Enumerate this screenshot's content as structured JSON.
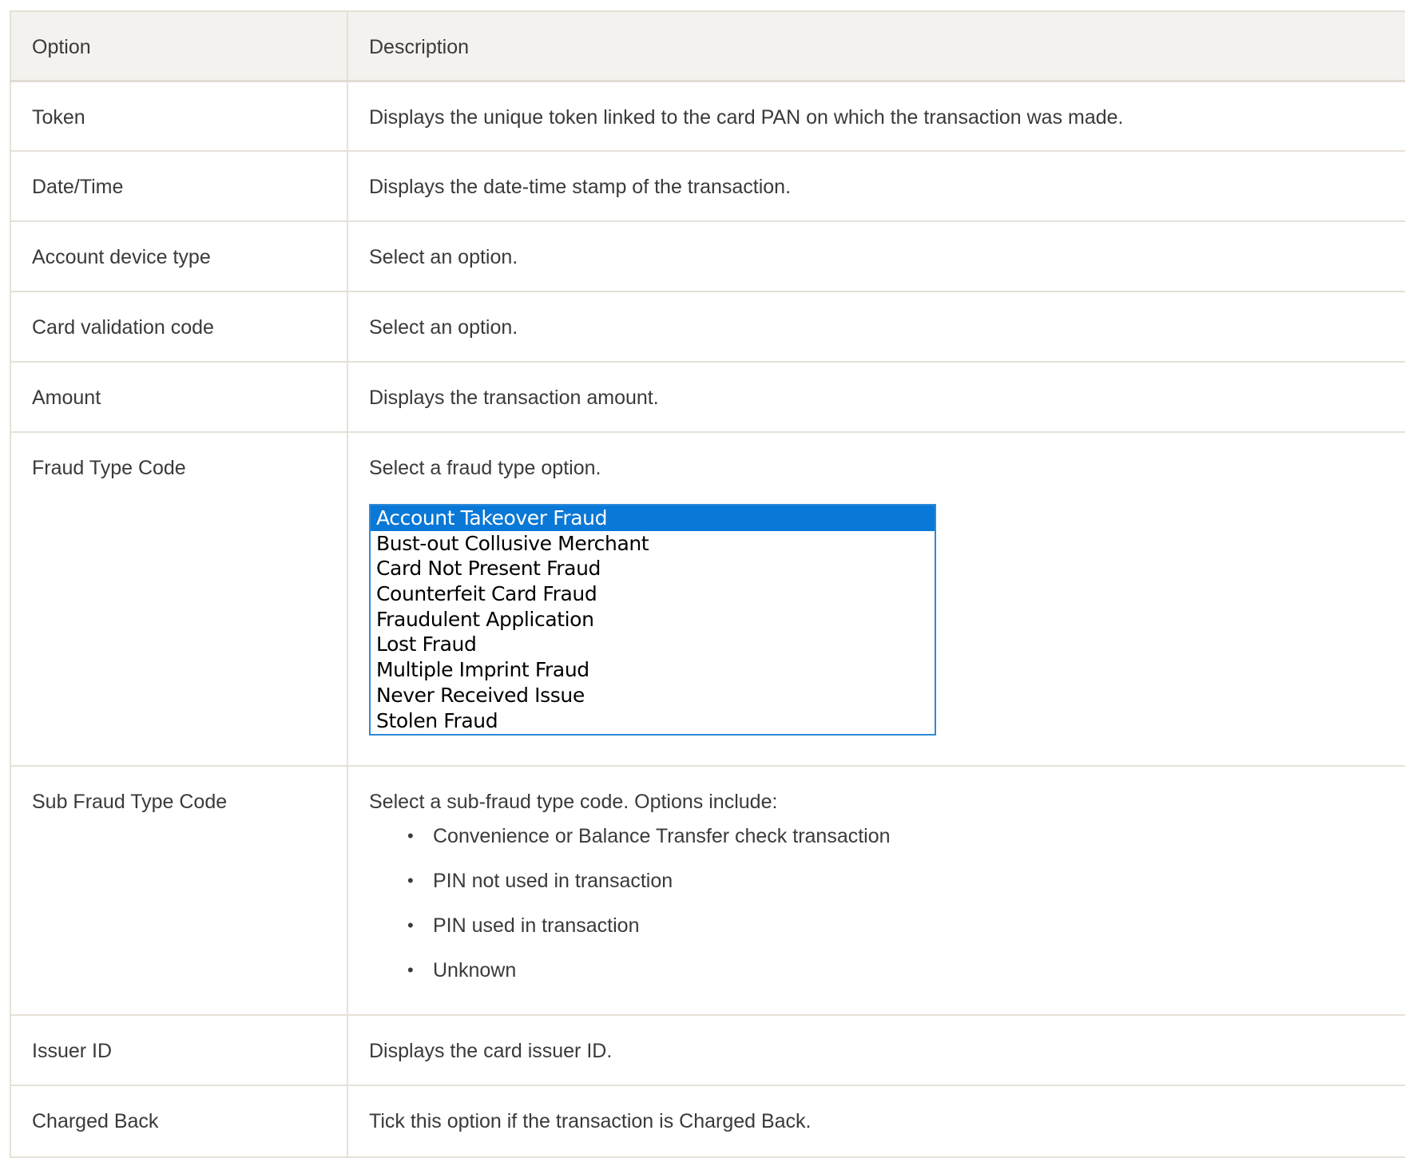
{
  "table": {
    "headers": {
      "option": "Option",
      "description": "Description"
    },
    "rows": [
      {
        "option": "Token",
        "description": "Displays the unique token linked to the card PAN on which the transaction was made."
      },
      {
        "option": "Date/Time",
        "description": "Displays the date-time stamp of the transaction."
      },
      {
        "option": "Account device type",
        "description": "Select an option."
      },
      {
        "option": "Card validation code",
        "description": "Select an option."
      },
      {
        "option": "Amount",
        "description": "Displays the transaction amount."
      },
      {
        "option": "Fraud Type Code",
        "description": "Select a fraud type option.",
        "listbox": {
          "selected": "Account Takeover Fraud",
          "options": [
            "Account Takeover Fraud",
            "Bust-out Collusive Merchant",
            "Card Not Present Fraud",
            "Counterfeit Card Fraud",
            "Fraudulent Application",
            "Lost Fraud",
            "Multiple Imprint Fraud",
            "Never Received Issue",
            "Stolen Fraud"
          ]
        }
      },
      {
        "option": "Sub Fraud Type Code",
        "description": "Select a sub-fraud type code. Options include:",
        "bullets": [
          "Convenience or Balance Transfer check transaction",
          "PIN not used in transaction",
          "PIN used in transaction",
          "Unknown"
        ]
      },
      {
        "option": "Issuer ID",
        "description": "Displays the card issuer ID."
      },
      {
        "option": "Charged Back",
        "description": "Tick this option if the transaction is Charged Back."
      }
    ]
  },
  "colors": {
    "header_bg": "#f4f2ee",
    "border": "#e6e1d8",
    "text": "#3a3a3a",
    "selection": "#0a78d7",
    "listbox_border": "#2b8ad8"
  },
  "icons": {
    "bullet": "bullet-icon"
  }
}
